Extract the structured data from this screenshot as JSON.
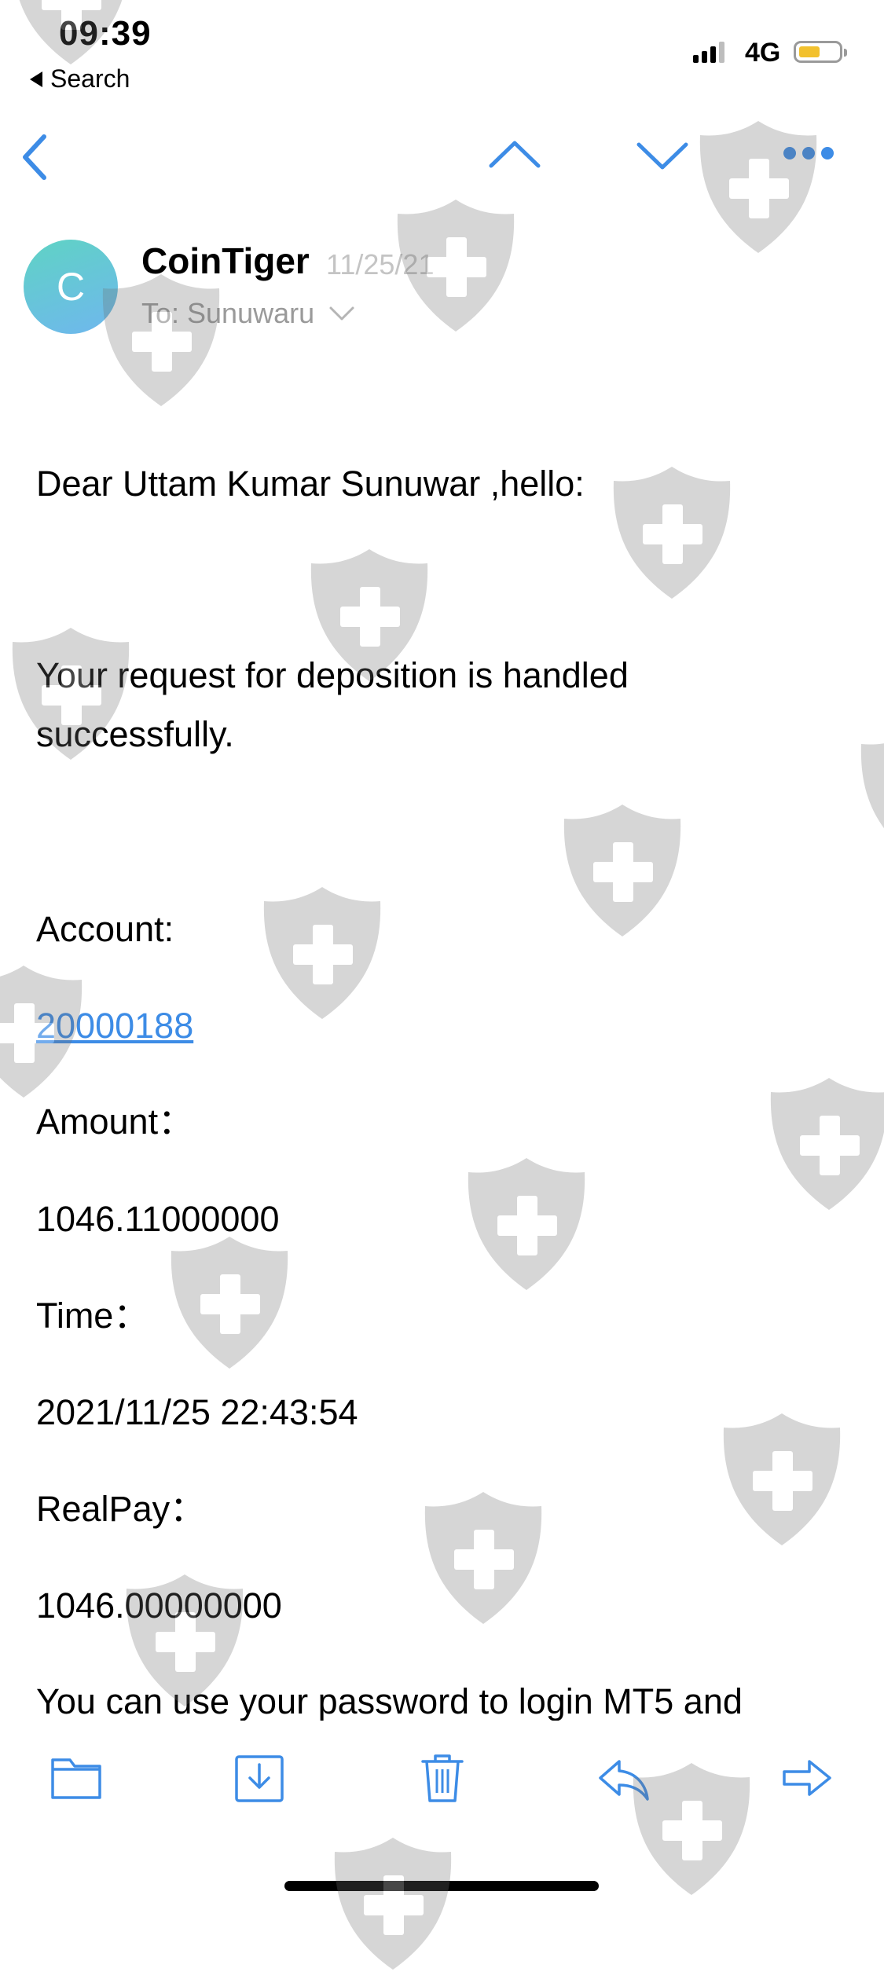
{
  "status_bar": {
    "time": "09:39",
    "back_app_label": "Search",
    "network": "4G"
  },
  "nav": {
    "icons": [
      "back-chevron-icon",
      "previous-message-icon",
      "next-message-icon",
      "more-icon"
    ]
  },
  "message": {
    "avatar_letter": "C",
    "sender": "CoinTiger",
    "date": "11/25/21",
    "to_label": "To: Sunuwaru",
    "greeting": "Dear Uttam Kumar Sunuwar ,hello:",
    "line1": "Your request for deposition is handled",
    "line2": "successfully.",
    "account_label": "Account:",
    "account_value": "20000188",
    "amount_label": "Amount：",
    "amount_value": "1046.11000000",
    "time_label": "Time：",
    "time_value": "2021/11/25 22:43:54",
    "realpay_label": "RealPay：",
    "realpay_value": "1046.00000000",
    "footer_line": "You can use your password to login MT5 and"
  },
  "toolbar": {
    "icons": [
      "folder-icon",
      "archive-icon",
      "trash-icon",
      "reply-icon",
      "forward-icon"
    ]
  },
  "colors": {
    "accent": "#3d8ce6",
    "avatar_start": "#5fd3c4",
    "avatar_end": "#6fb7ee",
    "battery": "#f2c12e"
  }
}
